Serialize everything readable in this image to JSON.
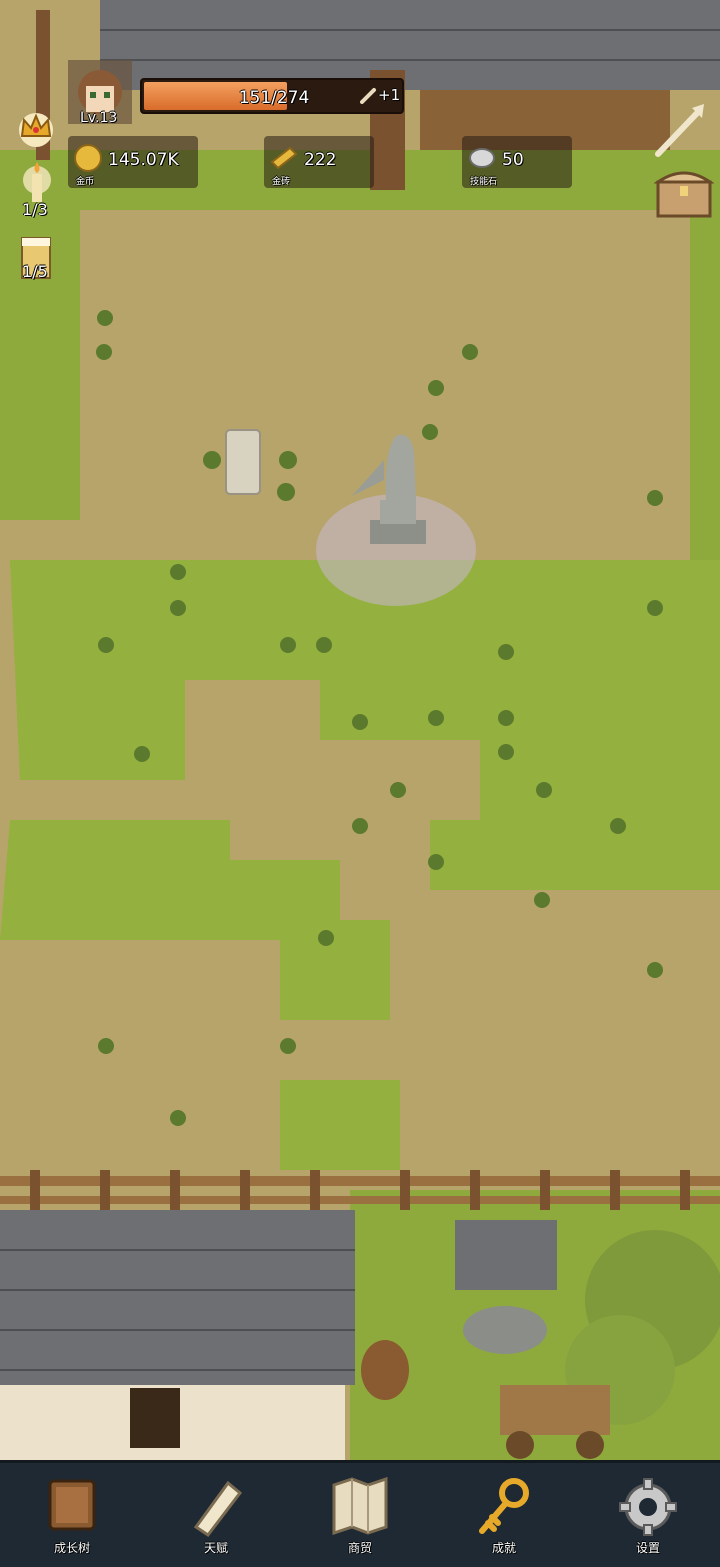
{
  "player": {
    "level": "Lv.13",
    "xp": "151/274",
    "xp_fraction": 0.55,
    "xp_bonus": "+1"
  },
  "resources": [
    {
      "value": "145.07K",
      "sub": "金币"
    },
    {
      "value": "222",
      "sub": "金砖"
    },
    {
      "value": "50",
      "sub": "技能石"
    }
  ],
  "side": {
    "candle_count": "1/3",
    "beer_count": "1/5"
  },
  "nav": [
    {
      "label": "成长树",
      "icon": "book-icon"
    },
    {
      "label": "天赋",
      "icon": "scroll-icon"
    },
    {
      "label": "商贸",
      "icon": "map-icon"
    },
    {
      "label": "成就",
      "icon": "key-icon"
    },
    {
      "label": "设置",
      "icon": "gear-icon"
    }
  ]
}
